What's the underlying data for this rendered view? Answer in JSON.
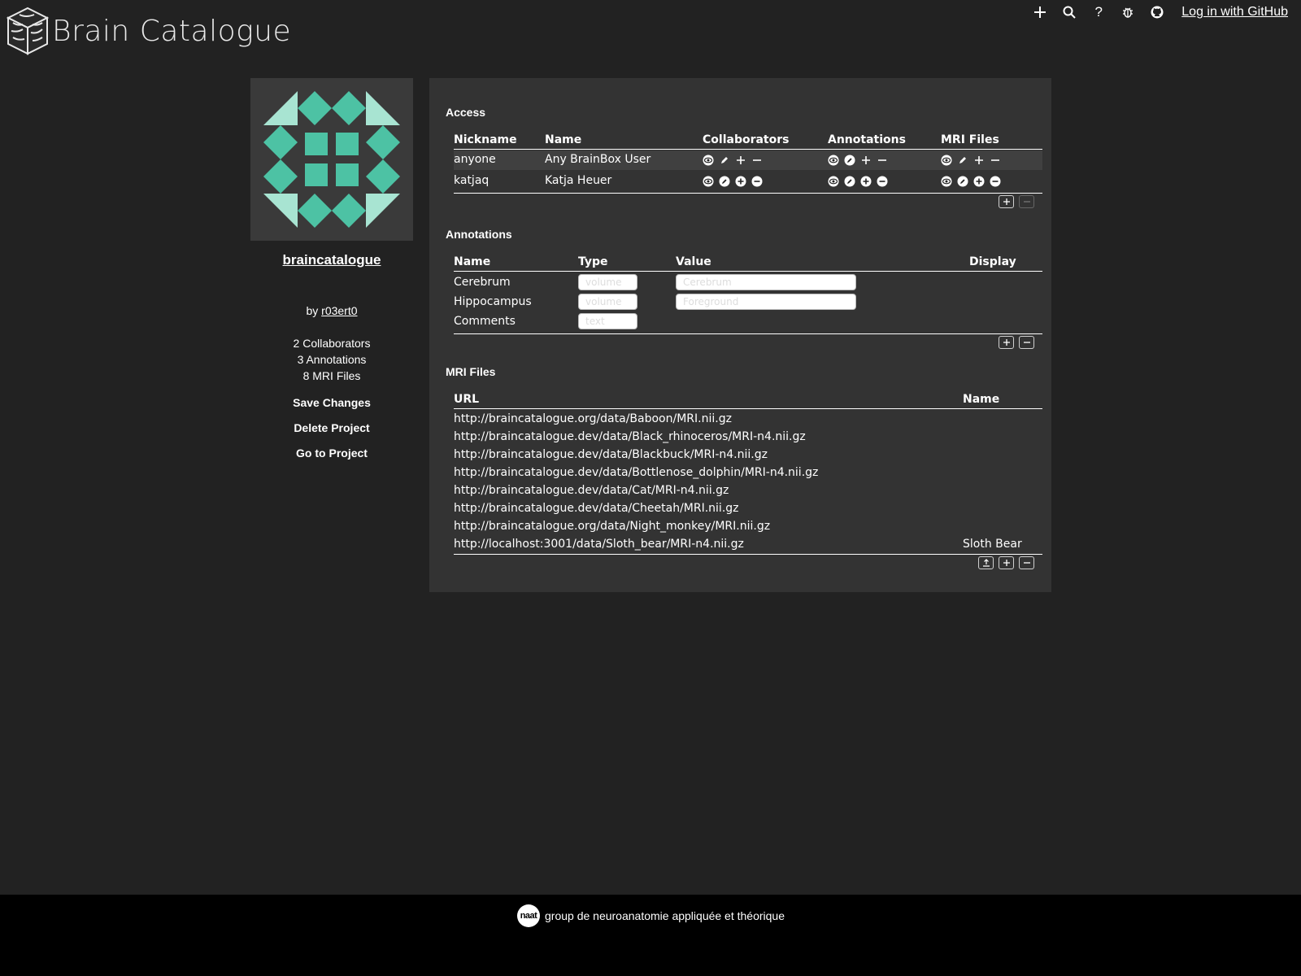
{
  "app": {
    "title": "Brain Catalogue"
  },
  "topbar": {
    "icons": [
      "plus-icon",
      "search-icon",
      "help-icon",
      "bug-icon",
      "github-icon"
    ],
    "help_glyph": "?",
    "login": "Log in with GitHub"
  },
  "project": {
    "name": "braincatalogue",
    "by_prefix": "by",
    "owner": "r03ert0",
    "stats": {
      "collaborators": "2 Collaborators",
      "annotations": "3 Annotations",
      "mri_files": "8 MRI Files"
    },
    "actions": {
      "save": "Save Changes",
      "delete": "Delete Project",
      "goto": "Go to Project"
    },
    "avatar_color": "#4dc2a4",
    "avatar_light_color": "#a8e4d2"
  },
  "access": {
    "title": "Access",
    "headers": {
      "nickname": "Nickname",
      "name": "Name",
      "collaborators": "Collaborators",
      "annotations": "Annotations",
      "mri_files": "MRI Files"
    },
    "rows": [
      {
        "nickname": "anyone",
        "name": "Any BrainBox User"
      },
      {
        "nickname": "katjaq",
        "name": "Katja Heuer"
      }
    ]
  },
  "annotations": {
    "title": "Annotations",
    "headers": {
      "name": "Name",
      "type": "Type",
      "value": "Value",
      "display": "Display"
    },
    "rows": [
      {
        "name": "Cerebrum",
        "type": "volume",
        "value": "Cerebrum"
      },
      {
        "name": "Hippocampus",
        "type": "volume",
        "value": "Foreground"
      },
      {
        "name": "Comments",
        "type": "text",
        "value": ""
      }
    ]
  },
  "mri": {
    "title": "MRI Files",
    "headers": {
      "url": "URL",
      "name": "Name"
    },
    "rows": [
      {
        "url": "http://braincatalogue.org/data/Baboon/MRI.nii.gz",
        "name": ""
      },
      {
        "url": "http://braincatalogue.dev/data/Black_rhinoceros/MRI-n4.nii.gz",
        "name": ""
      },
      {
        "url": "http://braincatalogue.dev/data/Blackbuck/MRI-n4.nii.gz",
        "name": ""
      },
      {
        "url": "http://braincatalogue.dev/data/Bottlenose_dolphin/MRI-n4.nii.gz",
        "name": ""
      },
      {
        "url": "http://braincatalogue.dev/data/Cat/MRI-n4.nii.gz",
        "name": ""
      },
      {
        "url": "http://braincatalogue.dev/data/Cheetah/MRI.nii.gz",
        "name": ""
      },
      {
        "url": "http://braincatalogue.org/data/Night_monkey/MRI.nii.gz",
        "name": ""
      },
      {
        "url": "http://localhost:3001/data/Sloth_bear/MRI-n4.nii.gz",
        "name": "Sloth Bear"
      }
    ]
  },
  "footer": {
    "logo_text": "naat",
    "text": "group de neuroanatomie appliquée et théorique"
  }
}
